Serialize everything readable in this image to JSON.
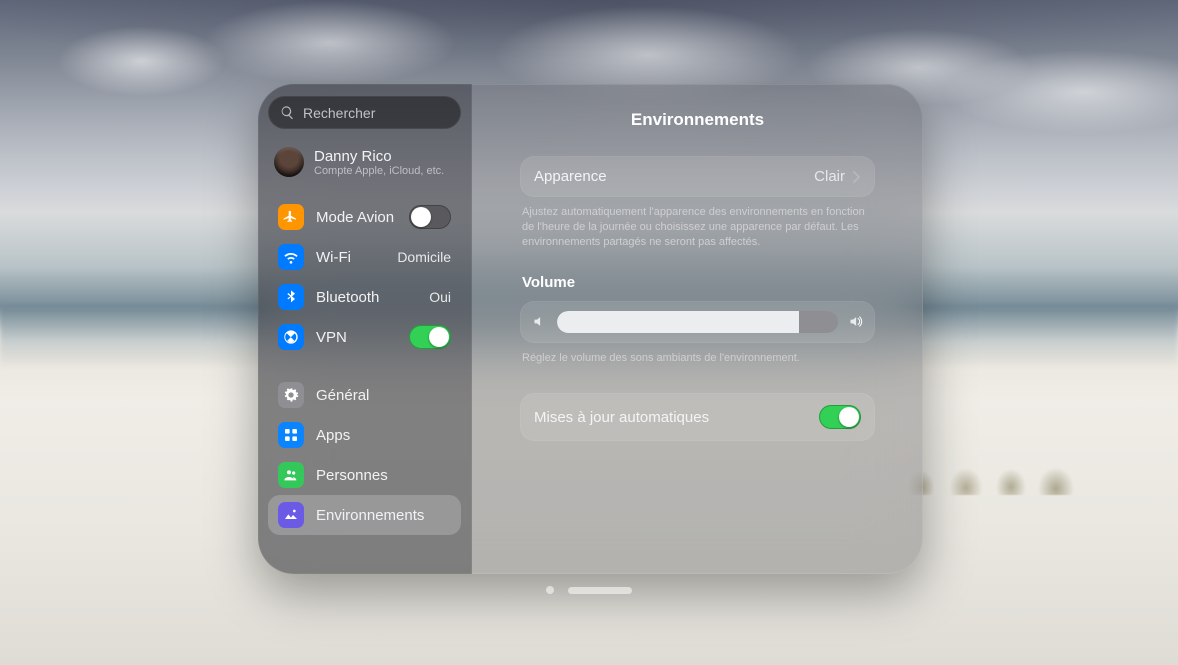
{
  "colors": {
    "accent_green": "#32d055",
    "accent_blue": "#0a84ff"
  },
  "search": {
    "placeholder": "Rechercher"
  },
  "account": {
    "name": "Danny Rico",
    "subtitle": "Compte Apple, iCloud, etc."
  },
  "sidebar": {
    "airplane": {
      "label": "Mode Avion",
      "on": false
    },
    "wifi": {
      "label": "Wi‑Fi",
      "value": "Domicile"
    },
    "bluetooth": {
      "label": "Bluetooth",
      "value": "Oui"
    },
    "vpn": {
      "label": "VPN",
      "on": true
    },
    "general": {
      "label": "Général"
    },
    "apps": {
      "label": "Apps"
    },
    "people": {
      "label": "Personnes"
    },
    "env": {
      "label": "Environnements",
      "selected": true
    }
  },
  "main": {
    "title": "Environnements",
    "appearance": {
      "label": "Apparence",
      "value": "Clair"
    },
    "appearance_hint": "Ajustez automatiquement l'apparence des environnements en fonction de l'heure de la journée ou choisissez une apparence par défaut. Les environnements partagés ne seront pas affectés.",
    "volume": {
      "title": "Volume",
      "percent": 86,
      "hint": "Réglez le volume des sons ambiants de l'environnement."
    },
    "auto_update": {
      "label": "Mises à jour automatiques",
      "on": true
    }
  }
}
